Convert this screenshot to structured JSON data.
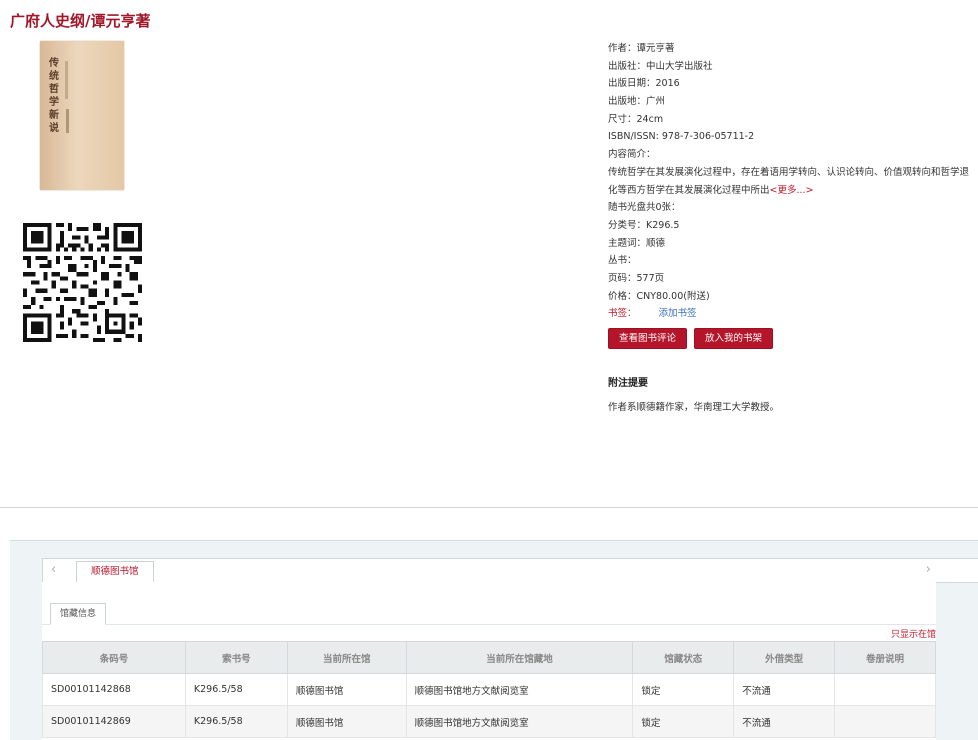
{
  "book": {
    "title": "广府人史纲/谭元亨著",
    "cover_title": "传统哲学新说"
  },
  "details": [
    {
      "label": "作者：",
      "value": "谭元亨著"
    },
    {
      "label": "出版社：",
      "value": "中山大学出版社"
    },
    {
      "label": "出版日期：",
      "value": "2016"
    },
    {
      "label": "出版地：",
      "value": "广州"
    },
    {
      "label": "尺寸：",
      "value": "24cm"
    },
    {
      "label": "ISBN/ISSN:",
      "value": "978-7-306-05711-2"
    },
    {
      "label": "内容简介：",
      "value": ""
    }
  ],
  "summary": {
    "text": "传统哲学在其发展演化过程中，存在着语用学转向、认识论转向、价值观转向和哲学退化等西方哲学在其发展演化过程中所出",
    "more": "<更多...>"
  },
  "details2": [
    {
      "label": "随书光盘共0张：",
      "value": ""
    },
    {
      "label": "分类号：",
      "value": "K296.5"
    },
    {
      "label": "主题词：",
      "value": "顺德"
    },
    {
      "label": "丛书：",
      "value": ""
    },
    {
      "label": "页码：",
      "value": "577页"
    },
    {
      "label": "价格：",
      "value": "CNY80.00(附送)"
    }
  ],
  "tags": {
    "label": "书签：",
    "link": "添加书签"
  },
  "buttons": {
    "reviews": "查看图书评论",
    "shelf": "放入我的书架"
  },
  "notes": {
    "heading": "附注提要",
    "text": "作者系顺德籍作家，华南理工大学教授。"
  },
  "holdings": {
    "library_tab": "顺德图书馆",
    "sub_tab": "馆藏信息",
    "only_show": "只显示在馆",
    "columns": [
      "条码号",
      "索书号",
      "当前所在馆",
      "当前所在馆藏地",
      "馆藏状态",
      "外借类型",
      "卷册说明"
    ],
    "rows": [
      [
        "SD00101142868",
        "K296.5/58",
        "顺德图书馆",
        "顺德图书馆地方文献阅览室",
        "锁定",
        "不流通",
        ""
      ],
      [
        "SD00101142869",
        "K296.5/58",
        "顺德图书馆",
        "顺德图书馆地方文献阅览室",
        "锁定",
        "不流通",
        ""
      ]
    ]
  },
  "icons": {
    "prev": "chevron-left-icon",
    "next": "chevron-right-icon"
  },
  "colors": {
    "brand": "#b5152a",
    "title": "#a0182a",
    "link": "#3a6fb5"
  }
}
